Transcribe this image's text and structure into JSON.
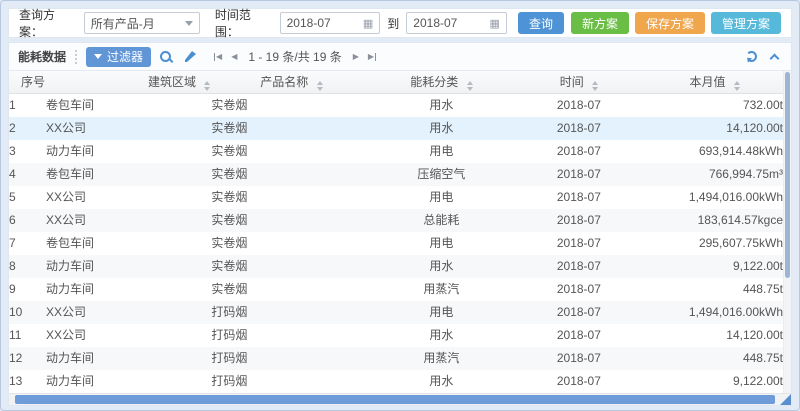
{
  "query_bar": {
    "plan_label": "查询方案：",
    "plan_value": "所有产品-月",
    "time_label": "时间范围：",
    "date_from": "2018-07",
    "to_label": "到",
    "date_to": "2018-07",
    "query_button": "查询",
    "new_plan_button": "新方案",
    "save_plan_button": "保存方案",
    "manage_plan_button": "管理方案"
  },
  "toolbar": {
    "title": "能耗数据",
    "filter_button": "过滤器",
    "pagination_info": "1 - 19 条/共 19 条"
  },
  "table": {
    "columns": [
      "序号",
      "建筑区域",
      "产品名称",
      "能耗分类",
      "时间",
      "本月值"
    ],
    "selected_index": 1,
    "rows": [
      [
        "1",
        "卷包车间",
        "实卷烟",
        "用水",
        "2018-07",
        "732.00t"
      ],
      [
        "2",
        "XX公司",
        "实卷烟",
        "用水",
        "2018-07",
        "14,120.00t"
      ],
      [
        "3",
        "动力车间",
        "实卷烟",
        "用电",
        "2018-07",
        "693,914.48kWh"
      ],
      [
        "4",
        "卷包车间",
        "实卷烟",
        "压缩空气",
        "2018-07",
        "766,994.75m³"
      ],
      [
        "5",
        "XX公司",
        "实卷烟",
        "用电",
        "2018-07",
        "1,494,016.00kWh"
      ],
      [
        "6",
        "XX公司",
        "实卷烟",
        "总能耗",
        "2018-07",
        "183,614.57kgce"
      ],
      [
        "7",
        "卷包车间",
        "实卷烟",
        "用电",
        "2018-07",
        "295,607.75kWh"
      ],
      [
        "8",
        "动力车间",
        "实卷烟",
        "用水",
        "2018-07",
        "9,122.00t"
      ],
      [
        "9",
        "动力车间",
        "实卷烟",
        "用蒸汽",
        "2018-07",
        "448.75t"
      ],
      [
        "10",
        "XX公司",
        "打码烟",
        "用电",
        "2018-07",
        "1,494,016.00kWh"
      ],
      [
        "11",
        "XX公司",
        "打码烟",
        "用水",
        "2018-07",
        "14,120.00t"
      ],
      [
        "12",
        "动力车间",
        "打码烟",
        "用蒸汽",
        "2018-07",
        "448.75t"
      ],
      [
        "13",
        "动力车间",
        "打码烟",
        "用水",
        "2018-07",
        "9,122.00t"
      ]
    ]
  },
  "icons": {
    "select_caret": "caret-down",
    "calendar": "▦",
    "filter": "funnel",
    "search": "magnifier",
    "clear_filter": "brush",
    "first_page": "|◀",
    "prev_page": "◀",
    "next_page": "▶",
    "last_page": "▶|",
    "refresh": "circular-arrow",
    "collapse": "chevron-up",
    "sort": "up-down-triangles"
  },
  "glyphs": {
    "calendar": "▦",
    "first": "|◀",
    "prev": "◀",
    "next": "▶",
    "last": "▶|"
  },
  "colors": {
    "query_button": "#4e93d5",
    "new_button": "#6abd45",
    "save_button": "#efa64d",
    "manage_button": "#57b9da",
    "filter_button": "#6095d6",
    "selected_row": "#e4f2fd",
    "hscroll_thumb": "#6f9bd8",
    "vscroll_thumb": "#9db4d4",
    "page_background": "#e3ebf6"
  }
}
